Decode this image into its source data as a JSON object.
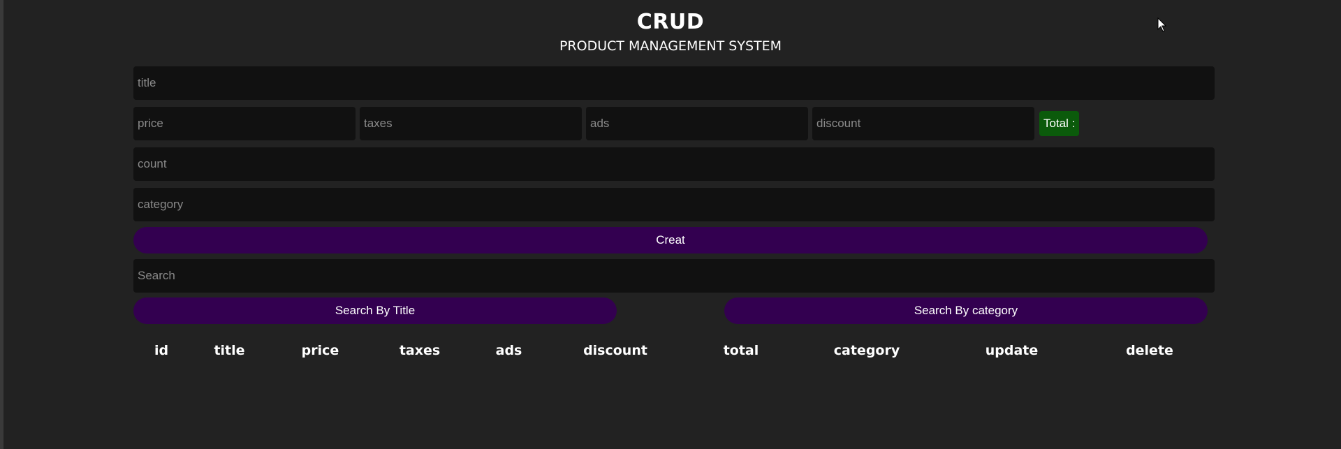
{
  "header": {
    "title": "CRUD",
    "subtitle": "PRODUCT MANAGEMENT SYSTEM"
  },
  "form": {
    "title_placeholder": "title",
    "price_placeholder": "price",
    "taxes_placeholder": "taxes",
    "ads_placeholder": "ads",
    "discount_placeholder": "discount",
    "total_label": "Total :",
    "count_placeholder": "count",
    "category_placeholder": "category",
    "create_label": "Creat"
  },
  "search": {
    "placeholder": "Search",
    "by_title_label": "Search By Title",
    "by_category_label": "Search By category"
  },
  "table": {
    "columns": [
      "id",
      "title",
      "price",
      "taxes",
      "ads",
      "discount",
      "total",
      "category",
      "update",
      "delete"
    ]
  },
  "colors": {
    "background": "#222222",
    "input_background": "#111111",
    "button_purple": "#330050",
    "total_green": "#0b5a0b"
  },
  "icons": {
    "cursor": "mouse-pointer-icon"
  }
}
